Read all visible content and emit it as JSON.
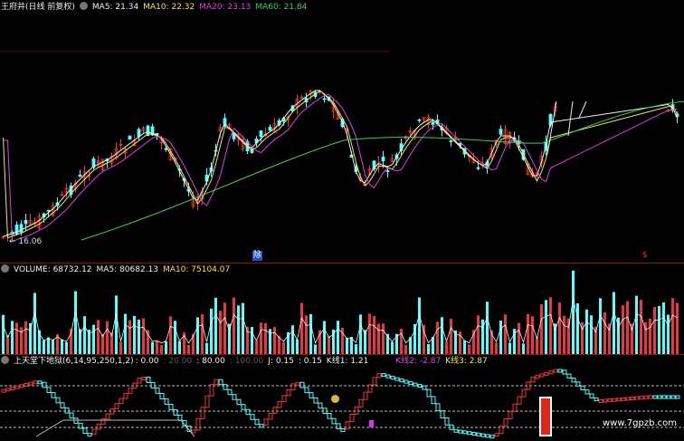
{
  "price_panel": {
    "title": "王府井(日线 前复权)",
    "ma5": "MA5: 21.34",
    "ma10": "MA10: 22.32",
    "ma20": "MA20: 23.13",
    "ma60": "MA60: 21.84",
    "low_marker": "← 16.06",
    "event_mark": "除",
    "signal_mark": "$"
  },
  "volume_panel": {
    "volume": "VOLUME: 68732.12",
    "ma5": "MA5: 80682.13",
    "ma10": "MA10: 75104.07"
  },
  "indicator_panel": {
    "name": "上天堂下地狱(6,14,95,250,1,2)",
    "v1": ": 0.00",
    "v2": ": 20.00",
    "v3": ": 80.00",
    "v4": ": 100.00",
    "j": "J: 0.15",
    "v6": ": 0.15",
    "k1": "K线1: 1.21",
    "k2": "K线2: -2.87",
    "k3": "K线3: 2.87"
  },
  "watermark": "www.7gpzb.com",
  "colors": {
    "up": "#e8383d",
    "down": "#54ffff",
    "ma5": "#f0f0f0",
    "ma10": "#f2e84a",
    "ma20": "#e43be4",
    "ma60": "#36d05a",
    "separator": "#8a1414"
  },
  "chart_data": [
    {
      "type": "candlestick",
      "title": "王府井(日线 前复权)",
      "series": [
        {
          "name": "MA5",
          "last": 21.34
        },
        {
          "name": "MA10",
          "last": 22.32
        },
        {
          "name": "MA20",
          "last": 23.13
        },
        {
          "name": "MA60",
          "last": 21.84
        }
      ],
      "annotations": [
        "← 16.06",
        "除",
        "$"
      ]
    },
    {
      "type": "bar",
      "title": "VOLUME",
      "series": [
        {
          "name": "VOLUME",
          "last": 68732.12
        },
        {
          "name": "MA5",
          "last": 80682.13
        },
        {
          "name": "MA10",
          "last": 75104.07
        }
      ]
    },
    {
      "type": "line",
      "title": "上天堂下地狱(6,14,95,250,1,2)",
      "levels": [
        0,
        20,
        80,
        100
      ],
      "series": [
        {
          "name": "J",
          "last": 0.15
        },
        {
          "name": "K线1",
          "last": 1.21
        },
        {
          "name": "K线2",
          "last": -2.87
        },
        {
          "name": "K线3",
          "last": 2.87
        }
      ]
    }
  ]
}
